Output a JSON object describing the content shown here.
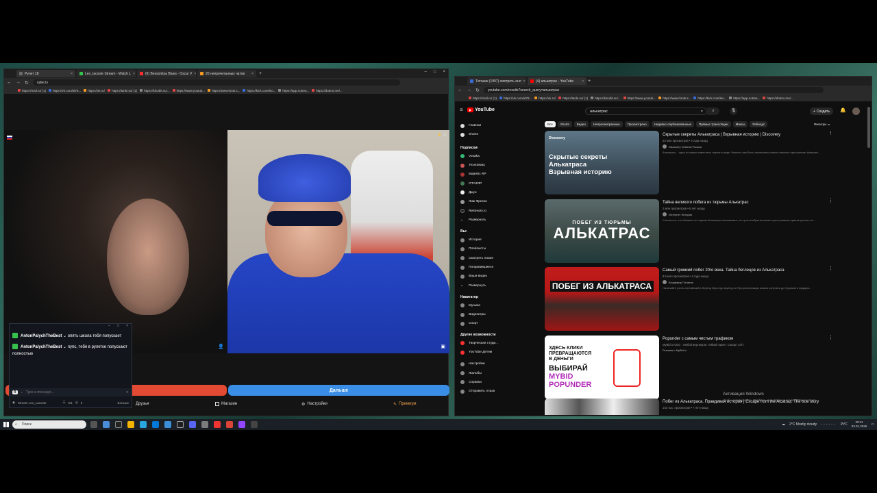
{
  "left_browser": {
    "tabs": [
      {
        "label": "Рулет 18",
        "color": "#6b6b6b"
      },
      {
        "label": "Leo_lacoste Stream - Watch L",
        "color": "#35c24d"
      },
      {
        "label": "(6) Bessonitsa Blues - Oscar V",
        "color": "#ff2d2d"
      },
      {
        "label": "20 непрочитанных чатов",
        "color": "#f59a23"
      }
    ],
    "url": "rullet.tv",
    "bookmarks": [
      "https://mail.ru/ (1)",
      "https://vk.com/id78...",
      "https://ok.ru/",
      "https://tanki.su/ (1)",
      "https://kinobit.su/...",
      "https://www.youtub...",
      "https://www.fonts.s...",
      "https://kick.com/leo...",
      "https://app.notrea...",
      "https://dotmo.me/..."
    ],
    "video_counter": "25",
    "next_button": "Дальше",
    "menu": {
      "friends": "Друзья",
      "shop": "Магазин",
      "settings": "Настройки",
      "premium": "Премиум"
    }
  },
  "chat": {
    "messages": [
      {
        "user": "AntonPalychTheBest",
        "text": "опять школа тебя попускает"
      },
      {
        "user": "AntonPalychTheBest",
        "text": "пупс, тебя в рулетке попускают полностью"
      }
    ],
    "input_placeholder": "Type a message...",
    "footer_channel": "Stream Leo_Lacoste",
    "footer_stats": [
      "5/1",
      "0"
    ],
    "footer_extra": "Больше"
  },
  "right_browser": {
    "tabs": [
      {
        "label": "Титаник (1997) смотреть онл",
        "color": "#3a6bd6"
      },
      {
        "label": "(4) алькатрас - YouTube",
        "color": "#ff0000"
      }
    ],
    "url": "youtube.com/results?search_query=алькатрас",
    "bookmarks": [
      "https://mail.ru/ (1)",
      "https://vk.com/id78...",
      "https://ok.ru/",
      "https://tanki.su/ (1)",
      "https://kinobit.su/...",
      "https://www.youtub...",
      "https://www.fonts.s...",
      "https://kick.com/leo...",
      "https://app.notrea...",
      "https://dotmo.me/..."
    ],
    "youtube": {
      "logo": "YouTube",
      "search_value": "алькатрас",
      "create_label": "Создать",
      "sidebar_main": [
        "Главная",
        "Shorts"
      ],
      "subs_header": "Подписки",
      "subs": [
        "Vosaka",
        "ТехноМакс",
        "Majestic RP",
        "ОТАЗЯР",
        "Джун",
        "Жак Фреско",
        "Restream.io",
        "Развернуть"
      ],
      "you_header": "Вы",
      "you_items": [
        "История",
        "Плейлисты",
        "Смотреть позже",
        "Понравившиеся",
        "Ваши видео",
        "Развернуть"
      ],
      "nav_header": "Навигатор",
      "nav_items": [
        "Музыка",
        "Видеоигры",
        "Спорт"
      ],
      "more_header": "Другие возможности",
      "more_items": [
        "Творческая студи...",
        "YouTube Детям"
      ],
      "settings_items": [
        "Настройки",
        "Жалобы",
        "Справка",
        "Отправить отзыв"
      ],
      "chips": [
        "Все",
        "Shorts",
        "Видео",
        "Непросмотренные",
        "Просмотрено",
        "Недавно опубликованные",
        "Прямые трансляции",
        "Миксы",
        "Ребилдс"
      ],
      "filters_label": "Фильтры",
      "results": [
        {
          "thumb_lines": [
            "Скрытые секреты",
            "Алькатраса",
            "Взрывная историю"
          ],
          "thumb_badge": "Discovery",
          "title": "Скрытые секреты Алькатраса | Взрывная историю | Discovery",
          "meta": "23 млн просмотров • 3 года назад",
          "channel": "Discovery Channel Россия",
          "desc": "Алькатрас – одна из самых известных тюрем в мире. Именно там были заключены самые опасные преступники Америки..."
        },
        {
          "thumb_lines": [
            "ПОБЕГ ИЗ ТЮРЬМЫ",
            "АЛЬКАТРАС"
          ],
          "title": "Тайна великого побега из тюрьмы Алькатрас",
          "meta": "2 млн просмотров • 5 лет назад",
          "channel": "Интернет История",
          "desc": "Считалось, что сбежать из тюрьмы Алькатрас невозможно, но трое изобретательных преступников сумели уплыть из..."
        },
        {
          "thumb_lines": [
            "ПОБЕГ ИЗ АЛЬКАТРАСА"
          ],
          "title": "Самый громкий побег 20го века. Тайна беглецов из Алькатраса",
          "meta": "8,5 млн просмотров • 3 года назад",
          "channel": "Владимир Потапов",
          "desc": "Начинайте учить английский в Skyeng https://go.skyeng.ru/ При регистрации можно получить до 3 уроков в подарок..."
        },
        {
          "thumb_lines": [
            "ЗДЕСЬ КЛИКИ",
            "ПРЕВРАЩАЮТСЯ",
            "В ДЕНЬГИ",
            "ВЫБИРАЙ",
            "MYBID",
            "POPUNDER"
          ],
          "title": "Popunder с самым чистым трафиком",
          "meta": "MyBid.io CEO · Любой вертикали. Гибкий таргет. Сапорт 24/7.",
          "channel": "Реклама • MyBid.io",
          "desc": ""
        },
        {
          "title": "Побег из Алькатраса. Правдивая история | Escape from the Alcatraz. The true story",
          "meta": "143 тыс. просмотров • 7 лет назад"
        }
      ]
    }
  },
  "watermark": {
    "line1": "Активация Windows",
    "line2": "Чтобы активировать Windows, перейдите в раздел \"Параметры\"."
  },
  "taskbar": {
    "search_placeholder": "Поиск",
    "weather": "2°C  Mostly cloudy",
    "lang": "РУС",
    "time": "20:11",
    "date": "03.01.2026"
  }
}
